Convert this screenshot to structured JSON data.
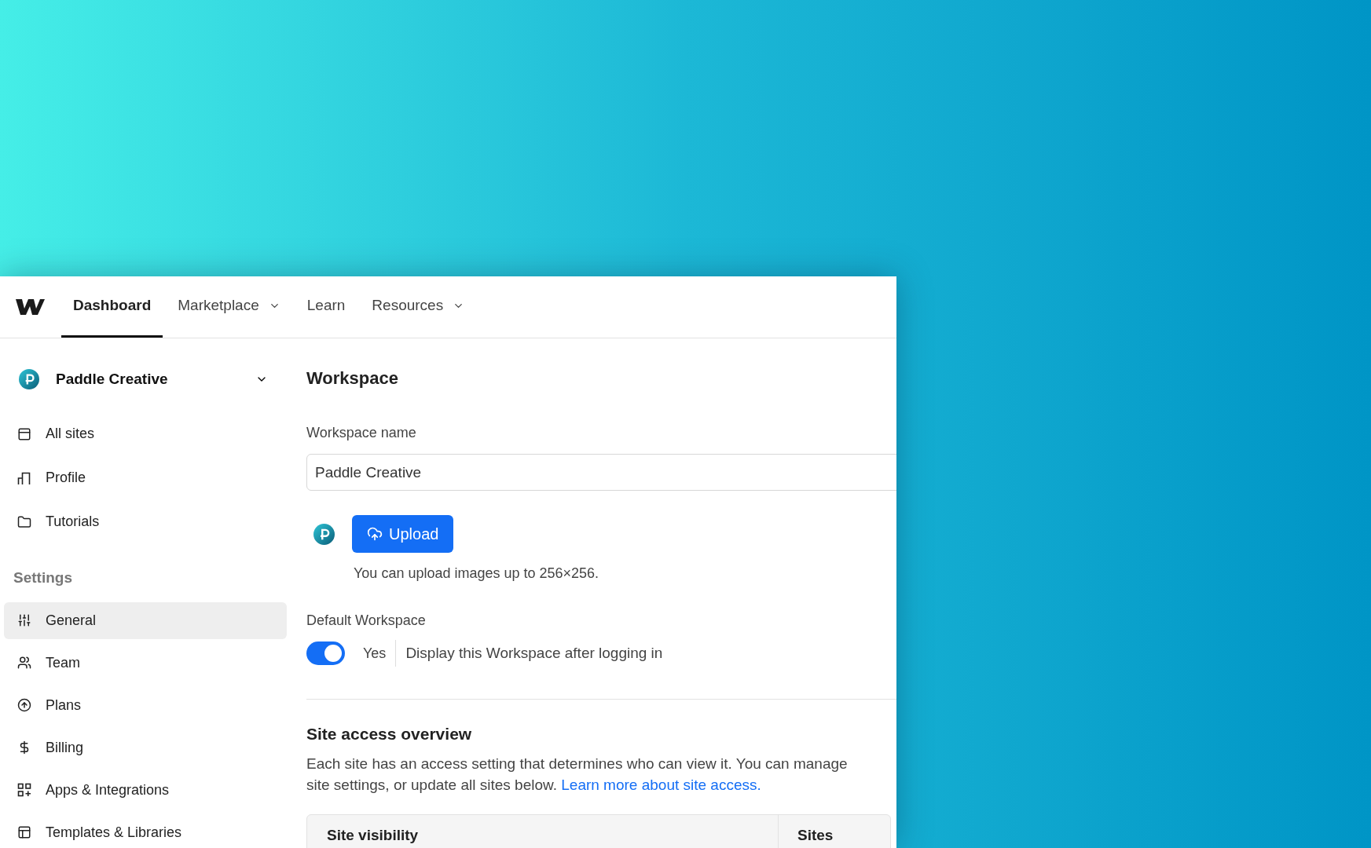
{
  "nav": {
    "tabs": [
      {
        "label": "Dashboard",
        "selected": true,
        "dropdown": false
      },
      {
        "label": "Marketplace",
        "selected": false,
        "dropdown": true
      },
      {
        "label": "Learn",
        "selected": false,
        "dropdown": false
      },
      {
        "label": "Resources",
        "selected": false,
        "dropdown": true
      }
    ]
  },
  "sidebar": {
    "workspace": "Paddle Creative",
    "items": [
      {
        "label": "All sites",
        "selected": false
      },
      {
        "label": "Profile",
        "selected": false
      },
      {
        "label": "Tutorials",
        "selected": false
      }
    ],
    "settings_heading": "Settings",
    "settings_items": [
      {
        "label": "General",
        "selected": true
      },
      {
        "label": "Team",
        "selected": false
      },
      {
        "label": "Plans",
        "selected": false
      },
      {
        "label": "Billing",
        "selected": false
      },
      {
        "label": "Apps & Integrations",
        "selected": false
      },
      {
        "label": "Templates & Libraries",
        "selected": false
      }
    ]
  },
  "content": {
    "title": "Workspace",
    "name_label": "Workspace name",
    "name_value": "Paddle Creative",
    "upload_button": "Upload",
    "upload_hint": "You can upload images up to 256×256.",
    "default_label": "Default Workspace",
    "default_toggle": {
      "on": true,
      "state_text": "Yes",
      "description": "Display this Workspace after logging in"
    },
    "access_title": "Site access overview",
    "access_text_lines": [
      "Each site has an access setting that determines who can view it. You can manage",
      "site settings, or update all sites below."
    ],
    "access_link": "Learn more about site access.",
    "table": {
      "columns": [
        "Site visibility",
        "Sites"
      ]
    }
  }
}
